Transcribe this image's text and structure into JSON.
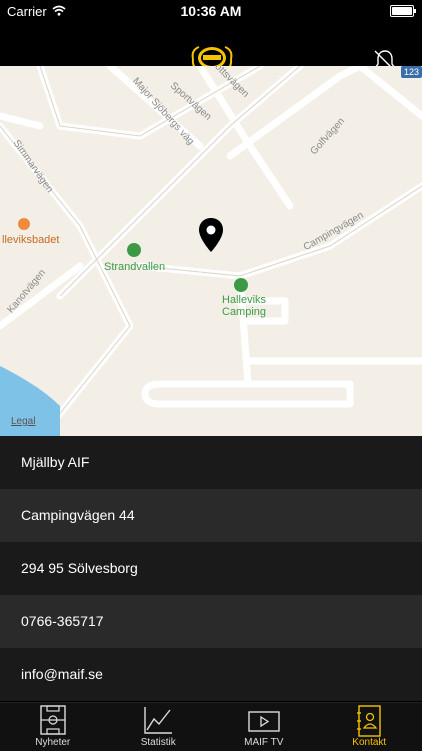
{
  "status_bar": {
    "carrier": "Carrier",
    "time": "10:36 AM"
  },
  "map": {
    "street_labels": [
      "Sportvägen",
      "Major Sjöbergs väg",
      "Golfvägen",
      "Simmarvägen",
      "Campingvägen",
      "Kanotvägen",
      "Idrottsvägen"
    ],
    "route_number": "123",
    "pois": {
      "poi1": "Strandvallen",
      "poi2": "Halleviks",
      "poi3": "Camping",
      "poi4": "lleviksbadet"
    },
    "legal": "Legal"
  },
  "contact": {
    "rows": [
      "Mjällby AIF",
      "Campingvägen 44",
      "294 95 Sölvesborg",
      "0766-365717",
      "info@maif.se"
    ]
  },
  "tabs": [
    {
      "label": "Nyheter"
    },
    {
      "label": "Statistik"
    },
    {
      "label": "MAIF TV"
    },
    {
      "label": "Kontakt"
    }
  ],
  "colors": {
    "accent": "#f5c400",
    "map_bg": "#f3efe7",
    "row_dark": "#1a1a1a",
    "row_light": "#2a2a2a",
    "poi_green": "#3c9a47"
  }
}
